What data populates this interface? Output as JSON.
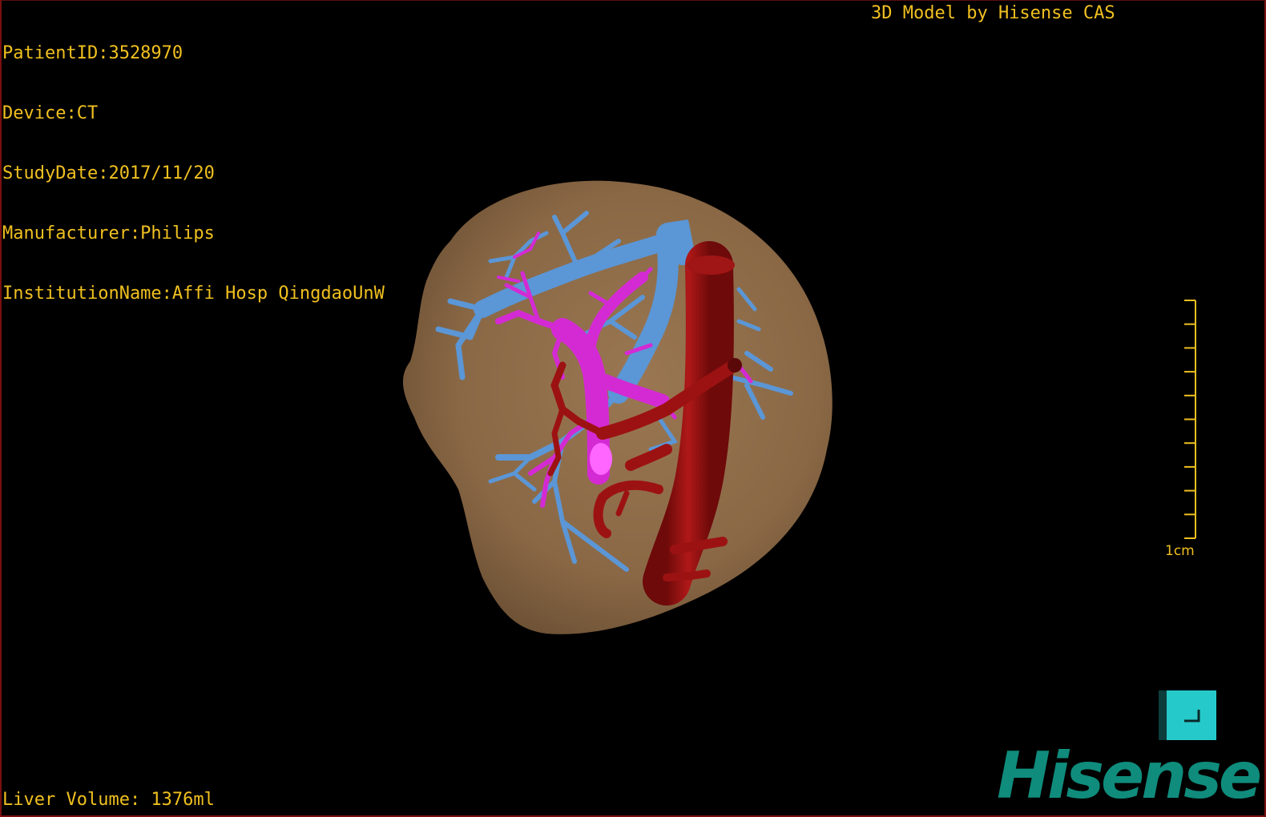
{
  "patient_info": {
    "patient_id": "PatientID:3528970",
    "device": "Device:CT",
    "study_date": "StudyDate:2017/11/20",
    "manufacturer": "Manufacturer:Philips",
    "institution": "InstitutionName:Affi Hosp QingdaoUnW"
  },
  "model_credit": "3D Model by Hisense CAS",
  "liver_volume": "Liver Volume: 1376ml",
  "scale": {
    "label": "1cm",
    "ticks": 10
  },
  "brand": {
    "logo_text": "Hisense",
    "color": "#0f8c7c"
  },
  "colors": {
    "overlay_text": "#f0c020",
    "liver": "#8c6a48",
    "hepatic_vein": "#5b96d6",
    "portal_vein": "#d42ad4",
    "artery": "#9c1212",
    "accent_button": "#26c9c9"
  },
  "corner_button": {
    "icon": "corner-bracket-icon"
  }
}
